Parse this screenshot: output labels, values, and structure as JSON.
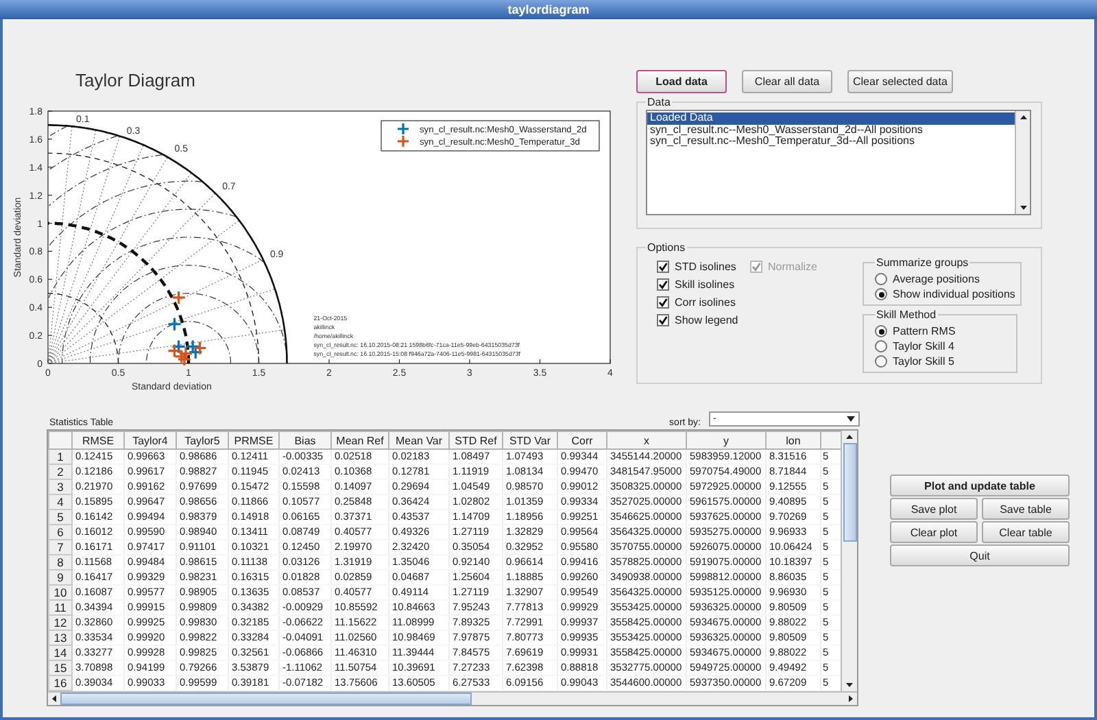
{
  "window": {
    "title": "taylordiagram"
  },
  "plot": {
    "chart_data": {
      "type": "scatter",
      "title": "Taylor Diagram",
      "xlabel": "Standard deviation",
      "ylabel": "Standard deviation",
      "xlim": [
        0,
        4
      ],
      "ylim": [
        0,
        1.8
      ],
      "xticks": [
        {
          "value": 0,
          "label": "0"
        },
        {
          "value": 0.5,
          "label": "0.5"
        },
        {
          "value": 1,
          "label": "1"
        },
        {
          "value": 1.5,
          "label": "1.5"
        },
        {
          "value": 2,
          "label": "2"
        },
        {
          "value": 2.5,
          "label": "2.5"
        },
        {
          "value": 3,
          "label": "3"
        },
        {
          "value": 3.5,
          "label": "3.5"
        },
        {
          "value": 4,
          "label": "4"
        }
      ],
      "yticks": [
        {
          "value": 0,
          "label": "0"
        },
        {
          "value": 0.2,
          "label": "0.2"
        },
        {
          "value": 0.4,
          "label": "0.4"
        },
        {
          "value": 0.6,
          "label": "0.6"
        },
        {
          "value": 0.8,
          "label": "0.8"
        },
        {
          "value": 1,
          "label": "1"
        },
        {
          "value": 1.2,
          "label": "1.2"
        },
        {
          "value": 1.4,
          "label": "1.4"
        },
        {
          "value": 1.6,
          "label": "1.6"
        },
        {
          "value": 1.8,
          "label": "1.8"
        }
      ],
      "series": [
        {
          "name": "syn_cl_result.nc:Mesh0_Wasserstand_2d",
          "color": "#0072bd",
          "x": [
            0.9,
            0.93,
            1.03,
            1.05
          ],
          "values": [
            0.28,
            0.12,
            0.12,
            0.08
          ]
        },
        {
          "name": "syn_cl_result.nc:Mesh0_Temperatur_3d",
          "color": "#d95319",
          "x": [
            0.93,
            0.9,
            0.95,
            0.97,
            1.08,
            0.98
          ],
          "values": [
            0.47,
            0.09,
            0.05,
            0.03,
            0.11,
            0.07
          ]
        }
      ],
      "annotations": [
        "0.1",
        "0.3",
        "0.5",
        "0.7",
        "0.9"
      ],
      "legend": true
    },
    "stamp": [
      "21-Oct-2015",
      "akillinck",
      "/home/akillinck",
      "syn_cl_result.nc: 16.10.2015-08:21 1598b6fc-71ca-11e5-99eb-64315035d73f",
      "syn_cl_result.nc: 16.10.2015-15:08 f946a72a-7406-11e5-9981-64315035d73f"
    ]
  },
  "top_buttons": [
    {
      "label": "Load data",
      "focused": true
    },
    {
      "label": "Clear all data",
      "focused": false
    },
    {
      "label": "Clear selected data",
      "focused": false
    }
  ],
  "data_panel": {
    "title": "Data",
    "items": [
      {
        "label": "Loaded Data",
        "selected": true
      },
      {
        "label": "syn_cl_result.nc--Mesh0_Wasserstand_2d--All positions",
        "selected": false
      },
      {
        "label": "syn_cl_result.nc--Mesh0_Temperatur_3d--All positions",
        "selected": false
      }
    ]
  },
  "options": {
    "title": "Options",
    "checkboxes": [
      {
        "label": "STD isolines",
        "checked": true,
        "disabled": false
      },
      {
        "label": "Skill isolines",
        "checked": true,
        "disabled": false
      },
      {
        "label": "Corr isolines",
        "checked": true,
        "disabled": false
      },
      {
        "label": "Show legend",
        "checked": true,
        "disabled": false
      }
    ],
    "normalize": {
      "label": "Normalize",
      "checked": true,
      "disabled": true
    },
    "summarize_groups": {
      "title": "Summarize groups",
      "options": [
        {
          "label": "Average positions",
          "selected": false
        },
        {
          "label": "Show individual positions",
          "selected": true
        }
      ]
    },
    "skill_method": {
      "title": "Skill Method",
      "options": [
        {
          "label": "Pattern RMS",
          "selected": true
        },
        {
          "label": "Taylor Skill 4",
          "selected": false
        },
        {
          "label": "Taylor Skill 5",
          "selected": false
        }
      ]
    }
  },
  "table": {
    "title": "Statistics Table",
    "sort": {
      "label": "sort by:",
      "value": "-"
    },
    "columns": [
      "RMSE",
      "Taylor4",
      "Taylor5",
      "PRMSE",
      "Bias",
      "Mean Ref",
      "Mean Var",
      "STD Ref",
      "STD Var",
      "Corr",
      "x",
      "y",
      "lon"
    ],
    "rows": [
      {
        "index": "1",
        "cells": [
          "0.12415",
          "0.99663",
          "0.98686",
          "0.12411",
          "-0.00335",
          "0.02518",
          "0.02183",
          "1.08497",
          "1.07493",
          "0.99344",
          "3455144.20000",
          "5983959.12000",
          "8.31516",
          "5"
        ]
      },
      {
        "index": "2",
        "cells": [
          "0.12186",
          "0.99617",
          "0.98827",
          "0.11945",
          "0.02413",
          "0.10368",
          "0.12781",
          "1.11919",
          "1.08134",
          "0.99470",
          "3481547.95000",
          "5970754.49000",
          "8.71844",
          "5"
        ]
      },
      {
        "index": "3",
        "cells": [
          "0.21970",
          "0.99162",
          "0.97699",
          "0.15472",
          "0.15598",
          "0.14097",
          "0.29694",
          "1.04549",
          "0.98570",
          "0.99012",
          "3508325.00000",
          "5972925.00000",
          "9.12555",
          "5"
        ]
      },
      {
        "index": "4",
        "cells": [
          "0.15895",
          "0.99647",
          "0.98656",
          "0.11866",
          "0.10577",
          "0.25848",
          "0.36424",
          "1.02802",
          "1.01359",
          "0.99334",
          "3527025.00000",
          "5961575.00000",
          "9.40895",
          "5"
        ]
      },
      {
        "index": "5",
        "cells": [
          "0.16142",
          "0.99494",
          "0.98379",
          "0.14918",
          "0.06165",
          "0.37371",
          "0.43537",
          "1.14709",
          "1.18956",
          "0.99251",
          "3546625.00000",
          "5937625.00000",
          "9.70269",
          "5"
        ]
      },
      {
        "index": "6",
        "cells": [
          "0.16012",
          "0.99590",
          "0.98940",
          "0.13411",
          "0.08749",
          "0.40577",
          "0.49326",
          "1.27119",
          "1.32829",
          "0.99564",
          "3564325.00000",
          "5935275.00000",
          "9.96933",
          "5"
        ]
      },
      {
        "index": "7",
        "cells": [
          "0.16171",
          "0.97417",
          "0.91101",
          "0.10321",
          "0.12450",
          "2.19970",
          "2.32420",
          "0.35054",
          "0.32952",
          "0.95580",
          "3570755.00000",
          "5926075.00000",
          "10.06424",
          "5"
        ]
      },
      {
        "index": "8",
        "cells": [
          "0.11568",
          "0.99484",
          "0.98615",
          "0.11138",
          "0.03126",
          "1.31919",
          "1.35046",
          "0.92140",
          "0.96614",
          "0.99416",
          "3578825.00000",
          "5919075.00000",
          "10.18397",
          "5"
        ]
      },
      {
        "index": "9",
        "cells": [
          "0.16417",
          "0.99329",
          "0.98231",
          "0.16315",
          "0.01828",
          "0.02859",
          "0.04687",
          "1.25604",
          "1.18885",
          "0.99260",
          "3490938.00000",
          "5998812.00000",
          "8.86035",
          "5"
        ]
      },
      {
        "index": "10",
        "cells": [
          "0.16087",
          "0.99577",
          "0.98905",
          "0.13635",
          "0.08537",
          "0.40577",
          "0.49114",
          "1.27119",
          "1.32907",
          "0.99549",
          "3564325.00000",
          "5935125.00000",
          "9.96930",
          "5"
        ]
      },
      {
        "index": "11",
        "cells": [
          "0.34394",
          "0.99915",
          "0.99809",
          "0.34382",
          "-0.00929",
          "10.85592",
          "10.84663",
          "7.95243",
          "7.77813",
          "0.99929",
          "3553425.00000",
          "5936325.00000",
          "9.80509",
          "5"
        ]
      },
      {
        "index": "12",
        "cells": [
          "0.32860",
          "0.99925",
          "0.99830",
          "0.32185",
          "-0.06622",
          "11.15622",
          "11.08999",
          "7.89325",
          "7.72991",
          "0.99937",
          "3558425.00000",
          "5934675.00000",
          "9.88022",
          "5"
        ]
      },
      {
        "index": "13",
        "cells": [
          "0.33534",
          "0.99920",
          "0.99822",
          "0.33284",
          "-0.04091",
          "11.02560",
          "10.98469",
          "7.97875",
          "7.80773",
          "0.99935",
          "3553425.00000",
          "5936325.00000",
          "9.80509",
          "5"
        ]
      },
      {
        "index": "14",
        "cells": [
          "0.33277",
          "0.99928",
          "0.99825",
          "0.32561",
          "-0.06866",
          "11.46310",
          "11.39444",
          "7.84575",
          "7.69619",
          "0.99931",
          "3558425.00000",
          "5934675.00000",
          "9.88022",
          "5"
        ]
      },
      {
        "index": "15",
        "cells": [
          "3.70898",
          "0.94199",
          "0.79266",
          "3.53879",
          "-1.11062",
          "11.50754",
          "10.39691",
          "7.27233",
          "7.62398",
          "0.88818",
          "3532775.00000",
          "5949725.00000",
          "9.49492",
          "5"
        ]
      },
      {
        "index": "16",
        "cells": [
          "0.39034",
          "0.99033",
          "0.99599",
          "0.39181",
          "-0.07182",
          "13.75606",
          "13.60505",
          "6.27533",
          "6.09156",
          "0.99043",
          "3544600.00000",
          "5937350.00000",
          "9.67209",
          "5"
        ]
      }
    ]
  },
  "actions": [
    {
      "label": "Plot and update table",
      "bold": true,
      "wide": true
    },
    {
      "label": "Save plot",
      "bold": false,
      "wide": false
    },
    {
      "label": "Save table",
      "bold": false,
      "wide": false
    },
    {
      "label": "Clear plot",
      "bold": false,
      "wide": false
    },
    {
      "label": "Clear table",
      "bold": false,
      "wide": false
    },
    {
      "label": "Quit",
      "bold": false,
      "wide": true
    }
  ]
}
